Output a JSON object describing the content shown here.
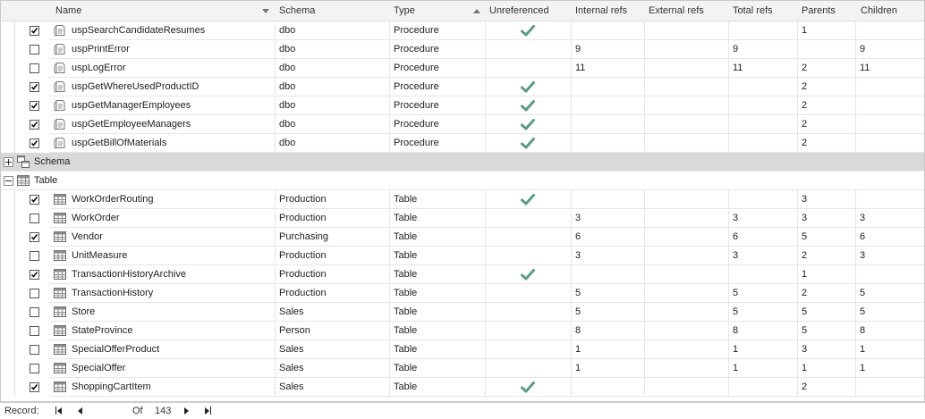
{
  "columns": [
    {
      "label": "Name",
      "key": "name",
      "sort": "desc"
    },
    {
      "label": "Schema",
      "key": "schema"
    },
    {
      "label": "Type",
      "key": "type",
      "sort": "asc"
    },
    {
      "label": "Unreferenced",
      "key": "unref"
    },
    {
      "label": "Internal refs",
      "key": "internal"
    },
    {
      "label": "External refs",
      "key": "external"
    },
    {
      "label": "Total refs",
      "key": "total"
    },
    {
      "label": "Parents",
      "key": "parents"
    },
    {
      "label": "Children",
      "key": "children"
    }
  ],
  "procedure_rows": [
    {
      "checked": true,
      "name": "uspSearchCandidateResumes",
      "schema": "dbo",
      "type": "Procedure",
      "unref": true,
      "internal": "",
      "external": "",
      "total": "",
      "parents": "1",
      "children": ""
    },
    {
      "checked": false,
      "name": "uspPrintError",
      "schema": "dbo",
      "type": "Procedure",
      "unref": false,
      "internal": "9",
      "external": "",
      "total": "9",
      "parents": "",
      "children": "9"
    },
    {
      "checked": false,
      "name": "uspLogError",
      "schema": "dbo",
      "type": "Procedure",
      "unref": false,
      "internal": "11",
      "external": "",
      "total": "11",
      "parents": "2",
      "children": "11"
    },
    {
      "checked": true,
      "name": "uspGetWhereUsedProductID",
      "schema": "dbo",
      "type": "Procedure",
      "unref": true,
      "internal": "",
      "external": "",
      "total": "",
      "parents": "2",
      "children": ""
    },
    {
      "checked": true,
      "name": "uspGetManagerEmployees",
      "schema": "dbo",
      "type": "Procedure",
      "unref": true,
      "internal": "",
      "external": "",
      "total": "",
      "parents": "2",
      "children": ""
    },
    {
      "checked": true,
      "name": "uspGetEmployeeManagers",
      "schema": "dbo",
      "type": "Procedure",
      "unref": true,
      "internal": "",
      "external": "",
      "total": "",
      "parents": "2",
      "children": ""
    },
    {
      "checked": true,
      "name": "uspGetBillOfMaterials",
      "schema": "dbo",
      "type": "Procedure",
      "unref": true,
      "internal": "",
      "external": "",
      "total": "",
      "parents": "2",
      "children": ""
    }
  ],
  "groups": {
    "schema": {
      "label": "Schema",
      "expanded": false
    },
    "table": {
      "label": "Table",
      "expanded": true
    }
  },
  "table_rows": [
    {
      "checked": true,
      "name": "WorkOrderRouting",
      "schema": "Production",
      "type": "Table",
      "unref": true,
      "internal": "",
      "external": "",
      "total": "",
      "parents": "3",
      "children": ""
    },
    {
      "checked": false,
      "name": "WorkOrder",
      "schema": "Production",
      "type": "Table",
      "unref": false,
      "internal": "3",
      "external": "",
      "total": "3",
      "parents": "3",
      "children": "3"
    },
    {
      "checked": true,
      "name": "Vendor",
      "schema": "Purchasing",
      "type": "Table",
      "unref": false,
      "internal": "6",
      "external": "",
      "total": "6",
      "parents": "5",
      "children": "6"
    },
    {
      "checked": false,
      "name": "UnitMeasure",
      "schema": "Production",
      "type": "Table",
      "unref": false,
      "internal": "3",
      "external": "",
      "total": "3",
      "parents": "2",
      "children": "3"
    },
    {
      "checked": true,
      "name": "TransactionHistoryArchive",
      "schema": "Production",
      "type": "Table",
      "unref": true,
      "internal": "",
      "external": "",
      "total": "",
      "parents": "1",
      "children": ""
    },
    {
      "checked": false,
      "name": "TransactionHistory",
      "schema": "Production",
      "type": "Table",
      "unref": false,
      "internal": "5",
      "external": "",
      "total": "5",
      "parents": "2",
      "children": "5"
    },
    {
      "checked": false,
      "name": "Store",
      "schema": "Sales",
      "type": "Table",
      "unref": false,
      "internal": "5",
      "external": "",
      "total": "5",
      "parents": "5",
      "children": "5"
    },
    {
      "checked": false,
      "name": "StateProvince",
      "schema": "Person",
      "type": "Table",
      "unref": false,
      "internal": "8",
      "external": "",
      "total": "8",
      "parents": "5",
      "children": "8"
    },
    {
      "checked": false,
      "name": "SpecialOfferProduct",
      "schema": "Sales",
      "type": "Table",
      "unref": false,
      "internal": "1",
      "external": "",
      "total": "1",
      "parents": "3",
      "children": "1"
    },
    {
      "checked": false,
      "name": "SpecialOffer",
      "schema": "Sales",
      "type": "Table",
      "unref": false,
      "internal": "1",
      "external": "",
      "total": "1",
      "parents": "1",
      "children": "1"
    },
    {
      "checked": true,
      "name": "ShoppingCartItem",
      "schema": "Sales",
      "type": "Table",
      "unref": true,
      "internal": "",
      "external": "",
      "total": "",
      "parents": "2",
      "children": ""
    }
  ],
  "status": {
    "record_label": "Record:",
    "of_label": "Of",
    "total": "143"
  },
  "colors": {
    "tick": "#5a9b88",
    "group_selected": "#d9d9d9",
    "header_bg": "#f3f3f3"
  },
  "icons": {
    "procedure": "stored-procedure-icon",
    "table": "table-icon",
    "schema": "schema-icon"
  }
}
